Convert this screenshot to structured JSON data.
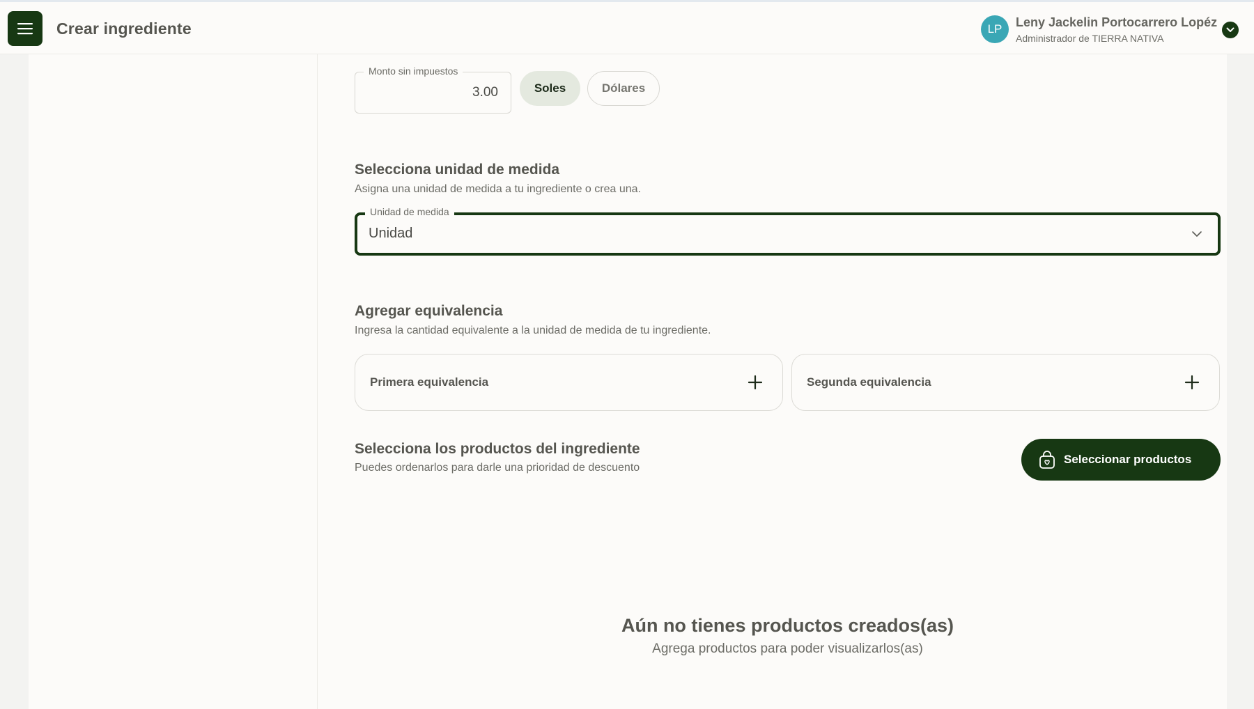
{
  "header": {
    "title": "Crear ingrediente",
    "menu_icon": "hamburger-menu-icon"
  },
  "user": {
    "initials": "LP",
    "name": "Leny Jackelin Portocarrero Lopéz",
    "role": "Administrador de TIERRA NATIVA",
    "toggle_icon": "chevron-down-icon"
  },
  "price": {
    "amount_label": "Monto sin impuestos",
    "amount_value": "3.00",
    "currencies": [
      {
        "label": "Soles",
        "selected": true
      },
      {
        "label": "Dólares",
        "selected": false
      }
    ]
  },
  "unit": {
    "title": "Selecciona unidad de medida",
    "subtitle": "Asigna una unidad de medida a tu ingrediente o crea una.",
    "select_label": "Unidad de medida",
    "select_value": "Unidad"
  },
  "equivalence": {
    "title": "Agregar equivalencia",
    "subtitle": "Ingresa la cantidad equivalente a la unidad de medida de tu ingrediente.",
    "first_label": "Primera equivalencia",
    "second_label": "Segunda equivalencia"
  },
  "products": {
    "title": "Selecciona los productos del ingrediente",
    "subtitle": "Puedes ordenarlos para darle una prioridad de descuento",
    "select_button": "Seleccionar productos",
    "button_icon": "shopping-bag-icon",
    "empty_title": "Aún no tienes productos creados(as)",
    "empty_subtitle": "Agrega productos para poder visualizarlos(as)"
  },
  "colors": {
    "primary": "#173813",
    "avatar": "#3aa7b5",
    "chip_active": "#e4e9df"
  }
}
